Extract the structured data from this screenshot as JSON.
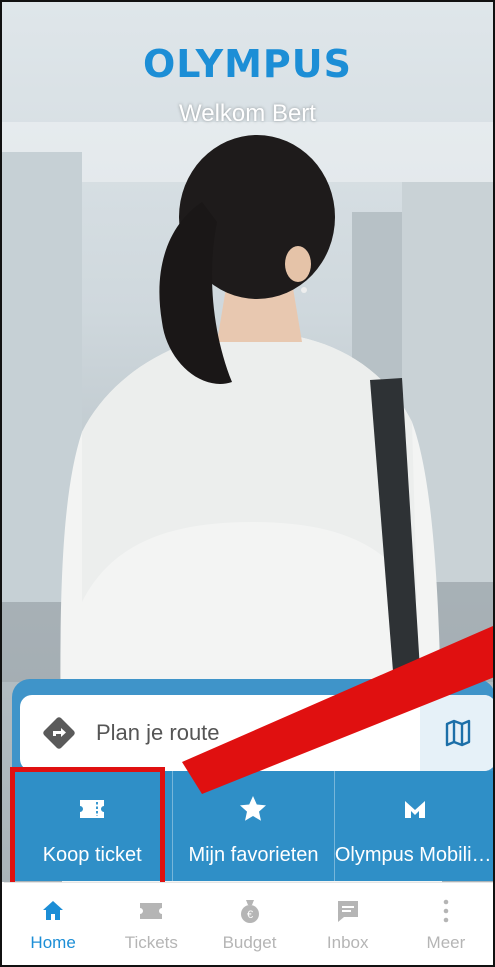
{
  "header": {
    "brand": "OLYMPUS",
    "welcome": "Welkom Bert"
  },
  "route": {
    "placeholder_text": "Plan je route",
    "route_icon": "directions-icon",
    "map_icon": "map-icon"
  },
  "actions": [
    {
      "label": "Koop ticket",
      "icon": "ticket-icon"
    },
    {
      "label": "Mijn favorieten",
      "icon": "star-icon"
    },
    {
      "label": "Olympus Mobility...",
      "icon": "mobility-logo-icon"
    }
  ],
  "bottom_nav": [
    {
      "label": "Home",
      "icon": "home-icon",
      "active": true
    },
    {
      "label": "Tickets",
      "icon": "ticket-icon",
      "active": false
    },
    {
      "label": "Budget",
      "icon": "money-bag-icon",
      "active": false
    },
    {
      "label": "Inbox",
      "icon": "inbox-icon",
      "active": false
    },
    {
      "label": "Meer",
      "icon": "more-icon",
      "active": false
    }
  ],
  "colors": {
    "brand_blue": "#1c8ed6",
    "panel_blue": "#2f8fc7",
    "highlight_red": "#e01010"
  }
}
